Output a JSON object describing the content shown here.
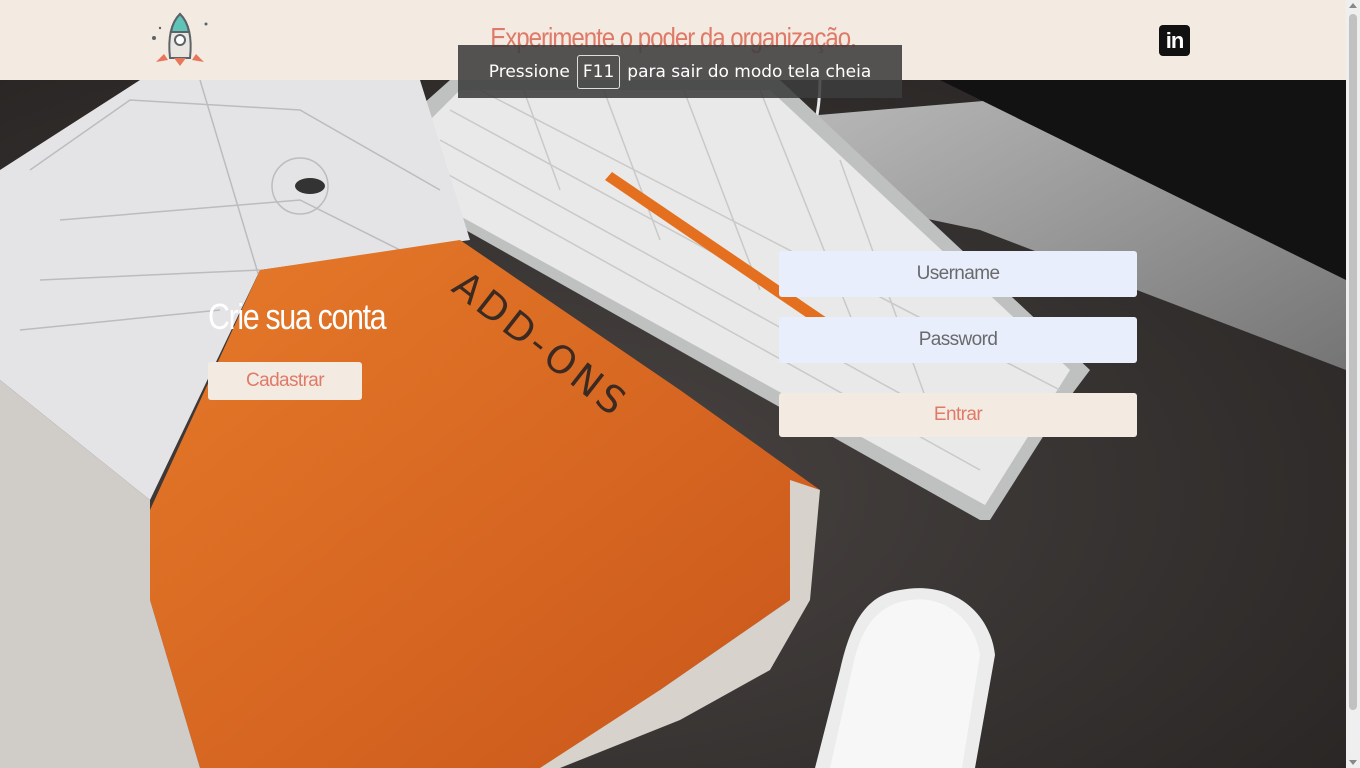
{
  "header": {
    "headline": "Experimente o poder da organização.",
    "logo_icon": "rocket-icon",
    "social_icon": "linkedin-icon",
    "social_label": "in"
  },
  "fullscreen_notice": {
    "prefix": "Pressione",
    "key": "F11",
    "suffix": "para sair do modo tela cheia"
  },
  "signup": {
    "title": "Crie sua conta",
    "button_label": "Cadastrar"
  },
  "login": {
    "username_placeholder": "Username",
    "password_placeholder": "Password",
    "submit_label": "Entrar"
  },
  "hero": {
    "book_text": "ADD-ONS"
  },
  "colors": {
    "accent": "#e07a68",
    "header_bg": "#f3ebe2",
    "input_bg": "#e8eefc"
  }
}
